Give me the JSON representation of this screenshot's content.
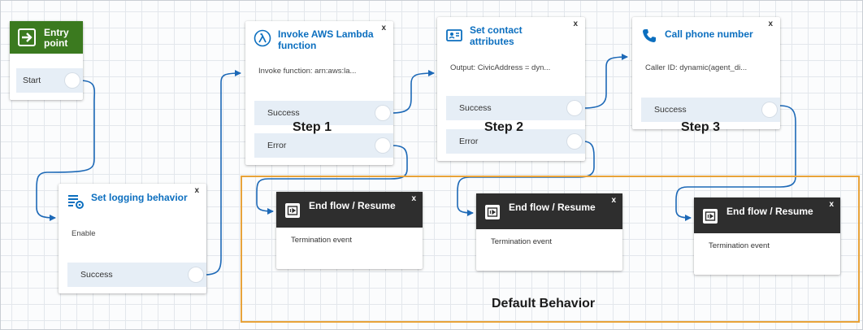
{
  "entry": {
    "title": "Entry point",
    "port": "Start",
    "color": "#3b7a1f"
  },
  "logging": {
    "title": "Set logging behavior",
    "close": "x",
    "desc": "Enable",
    "port": "Success"
  },
  "lambda": {
    "title": "Invoke AWS Lambda function",
    "close": "x",
    "desc": "Invoke function: arn:aws:la...",
    "ports": [
      "Success",
      "Error"
    ]
  },
  "contact": {
    "title": "Set contact attributes",
    "close": "x",
    "desc": "Output: CivicAddress = dyn...",
    "ports": [
      "Success",
      "Error"
    ]
  },
  "phone": {
    "title": "Call phone number",
    "close": "x",
    "desc": "Caller ID: dynamic(agent_di...",
    "port": "Success"
  },
  "end_flows": [
    {
      "title": "End flow / Resume",
      "close": "x",
      "desc": "Termination event"
    },
    {
      "title": "End flow / Resume",
      "close": "x",
      "desc": "Termination event"
    },
    {
      "title": "End flow / Resume",
      "close": "x",
      "desc": "Termination event"
    }
  ],
  "steps": [
    "Step 1",
    "Step 2",
    "Step 3"
  ],
  "default_behavior": "Default Behavior",
  "colors": {
    "accent": "#0c6fbf",
    "wire": "#1d69b7",
    "highlight": "#e8a33a",
    "end_flow_header": "#2e2e2e"
  }
}
